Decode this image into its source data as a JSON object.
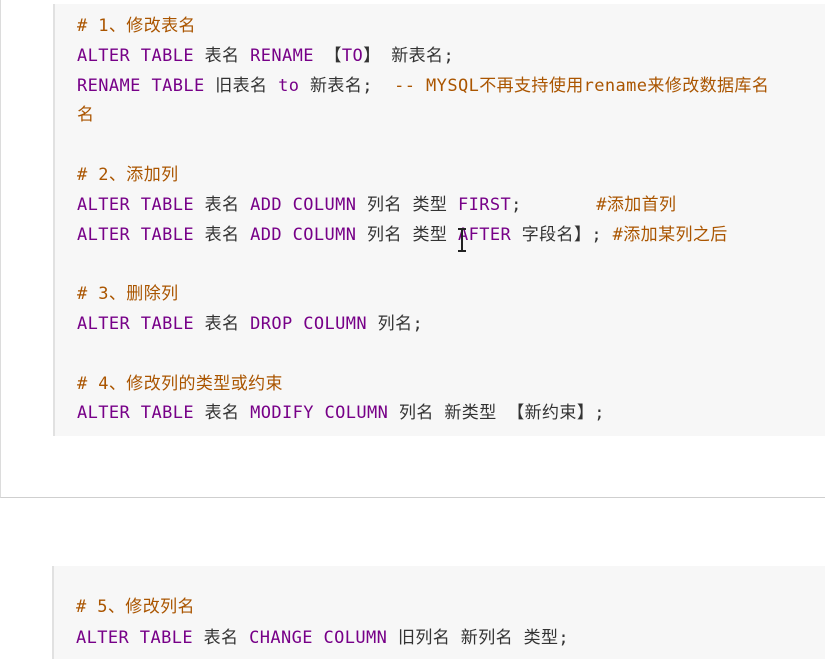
{
  "colors": {
    "keyword": "#770088",
    "comment": "#aa5500",
    "text": "#333333",
    "code_background": "#f7f7f7"
  },
  "code_block_top": {
    "lines": [
      {
        "tokens": [
          {
            "t": "c",
            "v": "# 1、修改表名"
          }
        ]
      },
      {
        "tokens": [
          {
            "t": "k",
            "v": "ALTER TABLE"
          },
          {
            "t": "x",
            "v": " 表名 "
          },
          {
            "t": "k",
            "v": "RENAME"
          },
          {
            "t": "x",
            "v": " 【"
          },
          {
            "t": "k",
            "v": "TO"
          },
          {
            "t": "x",
            "v": "】 新表名;"
          }
        ]
      },
      {
        "tokens": [
          {
            "t": "k",
            "v": "RENAME TABLE"
          },
          {
            "t": "x",
            "v": " 旧表名 "
          },
          {
            "t": "k",
            "v": "to"
          },
          {
            "t": "x",
            "v": " 新表名;  "
          },
          {
            "t": "c",
            "v": "-- MYSQL不再支持使用rename来修改数据库名"
          }
        ]
      },
      {
        "tokens": [
          {
            "t": "c",
            "v": "名"
          }
        ]
      },
      {
        "tokens": []
      },
      {
        "tokens": [
          {
            "t": "c",
            "v": "# 2、添加列"
          }
        ]
      },
      {
        "tokens": [
          {
            "t": "k",
            "v": "ALTER TABLE"
          },
          {
            "t": "x",
            "v": " 表名 "
          },
          {
            "t": "k",
            "v": "ADD COLUMN"
          },
          {
            "t": "x",
            "v": " 列名 类型 "
          },
          {
            "t": "k",
            "v": "FIRST"
          },
          {
            "t": "x",
            "v": ";       "
          },
          {
            "t": "c",
            "v": "#添加首列"
          }
        ]
      },
      {
        "tokens": [
          {
            "t": "k",
            "v": "ALTER TABLE"
          },
          {
            "t": "x",
            "v": " 表名 "
          },
          {
            "t": "k",
            "v": "ADD COLUMN"
          },
          {
            "t": "x",
            "v": " 列名 类型 "
          },
          {
            "t": "k",
            "v": "AFTER"
          },
          {
            "t": "x",
            "v": " 字段名】; "
          },
          {
            "t": "c",
            "v": "#添加某列之后"
          }
        ]
      },
      {
        "tokens": []
      },
      {
        "tokens": [
          {
            "t": "c",
            "v": "# 3、删除列"
          }
        ]
      },
      {
        "tokens": [
          {
            "t": "k",
            "v": "ALTER TABLE"
          },
          {
            "t": "x",
            "v": " 表名 "
          },
          {
            "t": "k",
            "v": "DROP COLUMN"
          },
          {
            "t": "x",
            "v": " 列名;"
          }
        ]
      },
      {
        "tokens": []
      },
      {
        "tokens": [
          {
            "t": "c",
            "v": "# 4、修改列的类型或约束"
          }
        ]
      },
      {
        "tokens": [
          {
            "t": "k",
            "v": "ALTER TABLE"
          },
          {
            "t": "x",
            "v": " 表名 "
          },
          {
            "t": "k",
            "v": "MODIFY COLUMN"
          },
          {
            "t": "x",
            "v": " 列名 新类型 【新约束】;"
          }
        ]
      }
    ]
  },
  "code_block_bottom": {
    "lines": [
      {
        "tokens": [
          {
            "t": "c",
            "v": "# 5、修改列名"
          }
        ]
      },
      {
        "tokens": [
          {
            "t": "k",
            "v": "ALTER TABLE"
          },
          {
            "t": "x",
            "v": " 表名 "
          },
          {
            "t": "k",
            "v": "CHANGE COLUMN"
          },
          {
            "t": "x",
            "v": " 旧列名 新列名 类型;"
          }
        ]
      }
    ]
  }
}
